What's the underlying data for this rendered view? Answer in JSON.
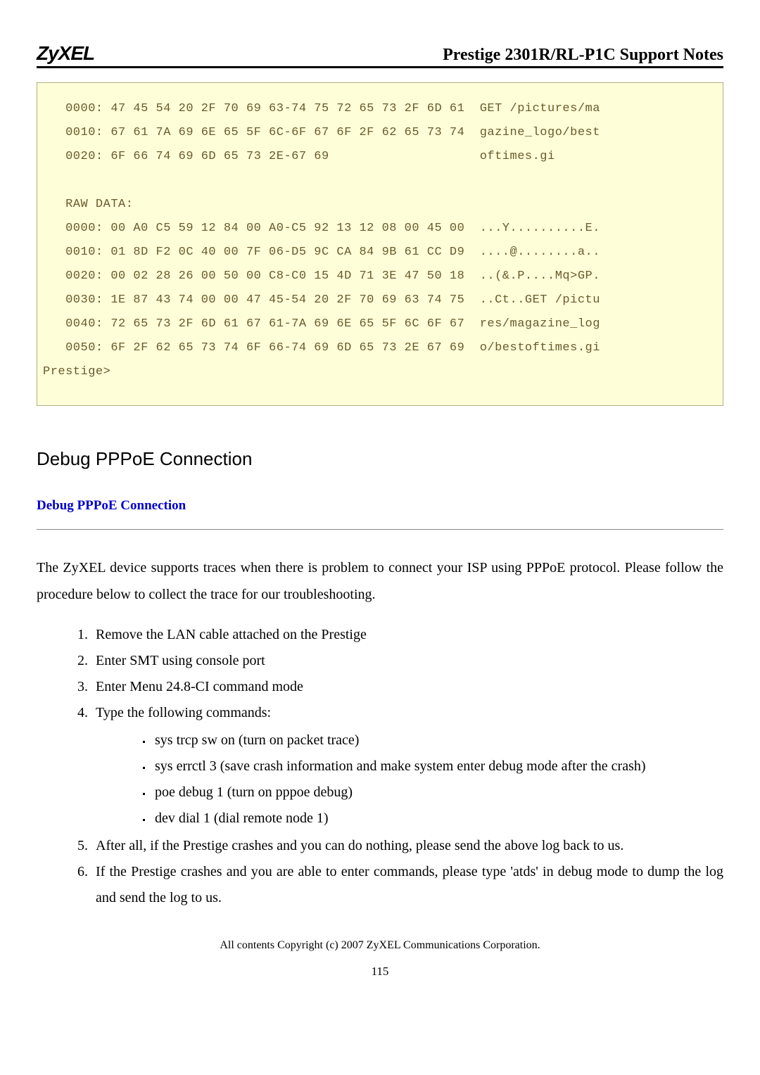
{
  "header": {
    "logo": "ZyXEL",
    "title": "Prestige 2301R/RL-P1C Support Notes"
  },
  "code_block": "   0000: 47 45 54 20 2F 70 69 63-74 75 72 65 73 2F 6D 61  GET /pictures/ma\n   0010: 67 61 7A 69 6E 65 5F 6C-6F 67 6F 2F 62 65 73 74  gazine_logo/best\n   0020: 6F 66 74 69 6D 65 73 2E-67 69                    oftimes.gi\n\n   RAW DATA:\n   0000: 00 A0 C5 59 12 84 00 A0-C5 92 13 12 08 00 45 00  ...Y..........E.\n   0010: 01 8D F2 0C 40 00 7F 06-D5 9C CA 84 9B 61 CC D9  ....@........a..\n   0020: 00 02 28 26 00 50 00 C8-C0 15 4D 71 3E 47 50 18  ..(&.P....Mq>GP.\n   0030: 1E 87 43 74 00 00 47 45-54 20 2F 70 69 63 74 75  ..Ct..GET /pictu\n   0040: 72 65 73 2F 6D 61 67 61-7A 69 6E 65 5F 6C 6F 67  res/magazine_log\n   0050: 6F 2F 62 65 73 74 6F 66-74 69 6D 65 73 2E 67 69  o/bestoftimes.gi\nPrestige>",
  "section_heading": "Debug PPPoE Connection",
  "link_heading": "Debug PPPoE Connection",
  "intro_paragraph": "The ZyXEL device supports traces when there is problem to connect your ISP using PPPoE protocol. Please follow the procedure below to collect the trace for our troubleshooting.",
  "steps": [
    "Remove the LAN cable attached on the Prestige",
    "Enter SMT using console port",
    "Enter Menu 24.8-CI command mode",
    "Type the following commands:",
    "After all, if the Prestige crashes and you can do nothing, please send the above log back to us.",
    "If the Prestige crashes and you are able to enter commands, please type 'atds' in debug mode to dump the log and send the log to us."
  ],
  "sub_commands": [
    "sys trcp sw on   (turn on packet trace)",
    "sys errctl 3 (save crash information and make system enter debug mode after the crash)",
    "poe debug 1 (turn on pppoe debug)",
    "dev dial 1 (dial remote node 1)"
  ],
  "footer": "All contents Copyright (c) 2007 ZyXEL Communications Corporation.",
  "page_number": "115"
}
